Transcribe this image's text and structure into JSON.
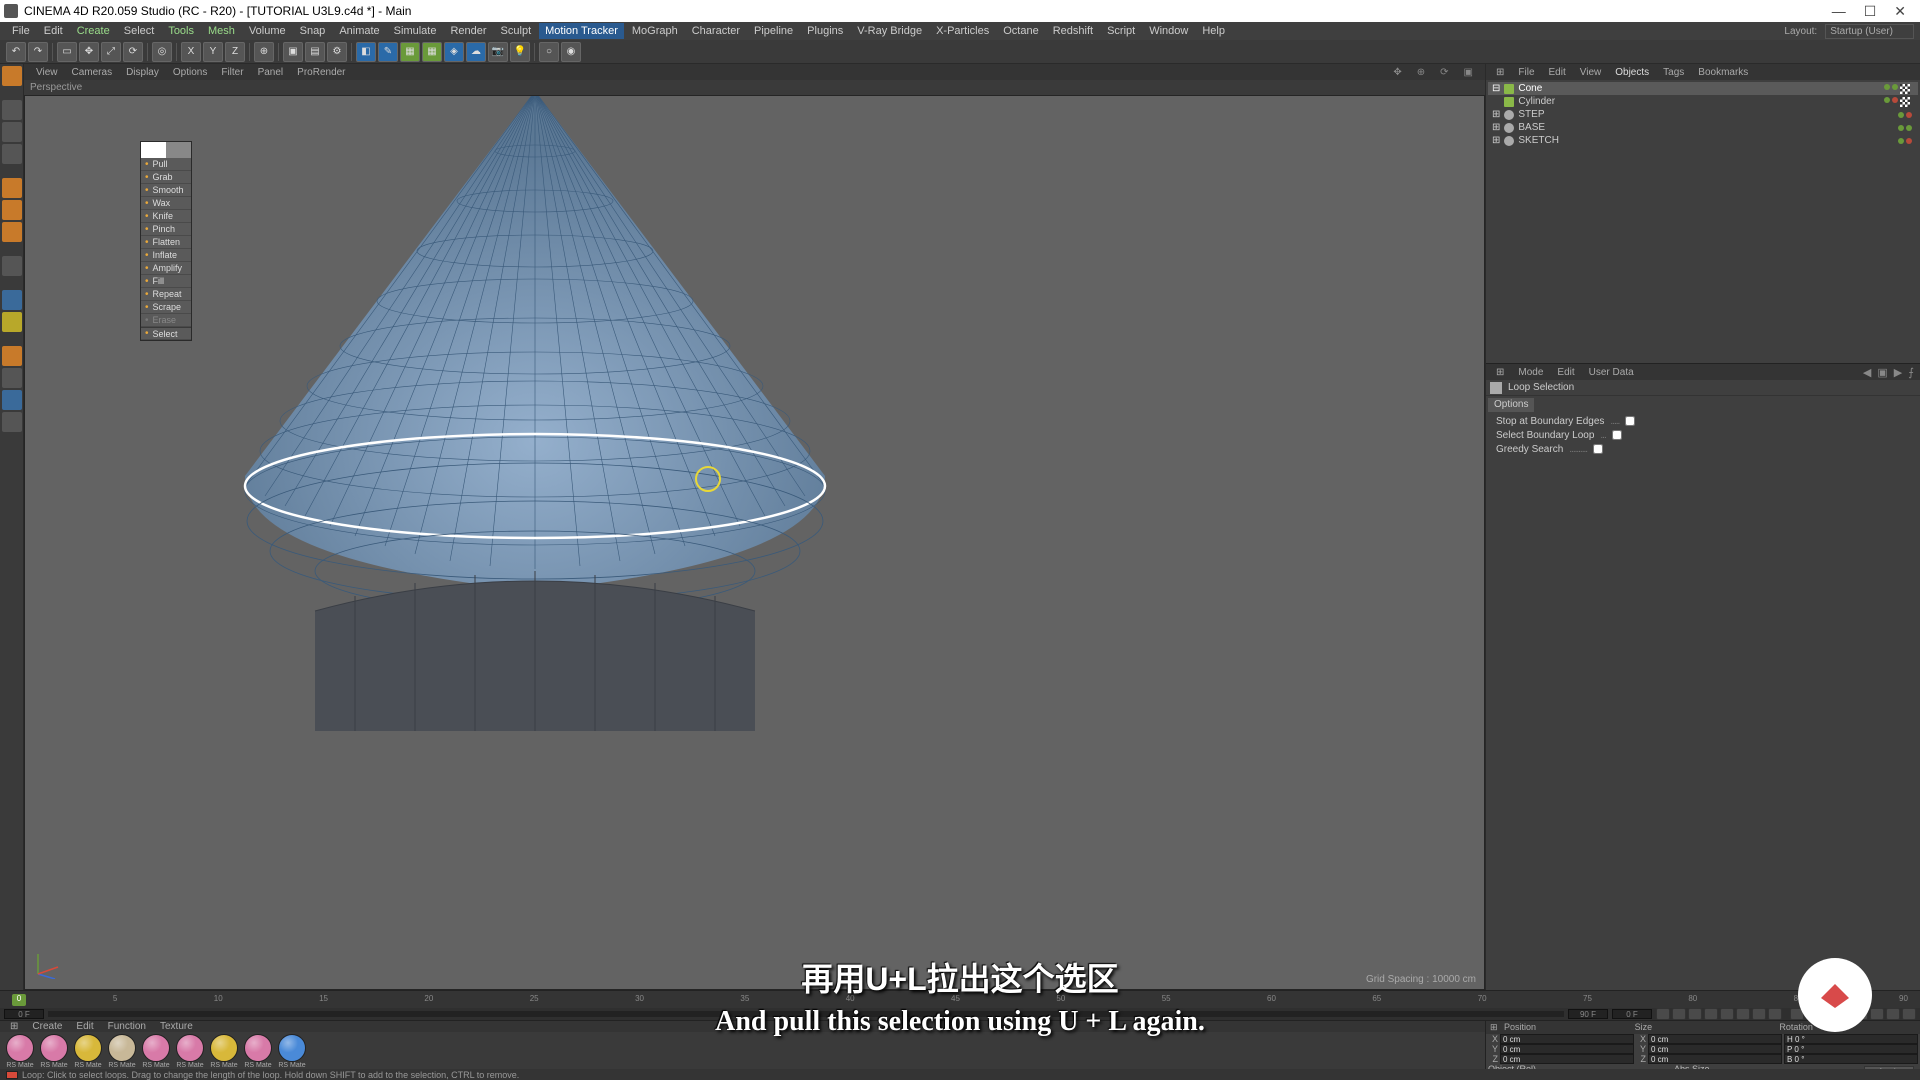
{
  "title": "CINEMA 4D R20.059 Studio (RC - R20) - [TUTORIAL U3L9.c4d *] - Main",
  "menu": [
    "File",
    "Edit",
    "Create",
    "Select",
    "Tools",
    "Mesh",
    "Volume",
    "Snap",
    "Animate",
    "Simulate",
    "Render",
    "Sculpt",
    "Motion Tracker",
    "MoGraph",
    "Character",
    "Pipeline",
    "Plugins",
    "V-Ray Bridge",
    "X-Particles",
    "Octane",
    "Redshift",
    "Script",
    "Window",
    "Help"
  ],
  "menu_active": "Motion Tracker",
  "layout_label": "Layout:",
  "layout_value": "Startup (User)",
  "vp_menu": [
    "View",
    "Cameras",
    "Display",
    "Options",
    "Filter",
    "Panel",
    "ProRender"
  ],
  "vp_label": "Perspective",
  "grid_spacing": "Grid Spacing : 10000 cm",
  "sculpt_tools": [
    "Pull",
    "Grab",
    "Smooth",
    "Wax",
    "Knife",
    "Pinch",
    "Flatten",
    "Inflate",
    "Amplify",
    "Fill",
    "Repeat",
    "Scrape"
  ],
  "sculpt_disabled": "Erase",
  "sculpt_select": "Select",
  "obj_tabs": [
    "File",
    "Edit",
    "View",
    "Objects",
    "Tags",
    "Bookmarks"
  ],
  "obj_tab_active": "Objects",
  "objects": [
    {
      "name": "Cone",
      "selected": true,
      "indent": 0,
      "icon": "cone",
      "tag": true
    },
    {
      "name": "Cylinder",
      "selected": false,
      "indent": 0,
      "icon": "cone",
      "tag": true
    },
    {
      "name": "STEP",
      "selected": false,
      "indent": 0,
      "icon": "null",
      "tag": false
    },
    {
      "name": "BASE",
      "selected": false,
      "indent": 0,
      "icon": "null",
      "tag": false
    },
    {
      "name": "SKETCH",
      "selected": false,
      "indent": 0,
      "icon": "null",
      "tag": false
    }
  ],
  "attr_tabs": [
    "Mode",
    "Edit",
    "User Data"
  ],
  "attr_title": "Loop Selection",
  "attr_section": "Options",
  "attr_opts": [
    {
      "label": "Stop at Boundary Edges",
      "checked": false
    },
    {
      "label": "Select Boundary Loop",
      "checked": false
    },
    {
      "label": "Greedy Search",
      "checked": false
    }
  ],
  "timeline_ticks": [
    "0",
    "5",
    "10",
    "15",
    "20",
    "25",
    "30",
    "35",
    "40",
    "45",
    "50",
    "55",
    "60",
    "65",
    "70",
    "75",
    "80",
    "85",
    "90"
  ],
  "timeline_frame": "0",
  "timerange_start": "0 F",
  "timerange_end": "90 F",
  "timerange_cur": "0 F",
  "mat_menu": [
    "Create",
    "Edit",
    "Function",
    "Texture"
  ],
  "materials": [
    {
      "color": "pink",
      "label": "RS Mate"
    },
    {
      "color": "pink",
      "label": "RS Mate"
    },
    {
      "color": "gold",
      "label": "RS Mate"
    },
    {
      "color": "beige",
      "label": "RS Mate"
    },
    {
      "color": "pink",
      "label": "RS Mate"
    },
    {
      "color": "pink",
      "label": "RS Mate"
    },
    {
      "color": "gold",
      "label": "RS Mate"
    },
    {
      "color": "pink",
      "label": "RS Mate"
    },
    {
      "color": "blue",
      "label": "RS Mate"
    }
  ],
  "coord_head": [
    "Position",
    "Size",
    "Rotation"
  ],
  "coord_rows": [
    {
      "axis": "X",
      "p": "0 cm",
      "s": "0 cm",
      "r": "H  0 °"
    },
    {
      "axis": "Y",
      "p": "0 cm",
      "s": "0 cm",
      "r": "P  0 °"
    },
    {
      "axis": "Z",
      "p": "0 cm",
      "s": "0 cm",
      "r": "B  0 °"
    }
  ],
  "coord_mode1": "Object (Rel)",
  "coord_mode2": "Abs Size",
  "coord_apply": "Apply",
  "status": "Loop: Click to select loops. Drag to change the length of the loop. Hold down SHIFT to add to the selection, CTRL to remove.",
  "subtitle_cn": "再用U+L拉出这个选区",
  "subtitle_en": "And pull this selection using U + L again."
}
